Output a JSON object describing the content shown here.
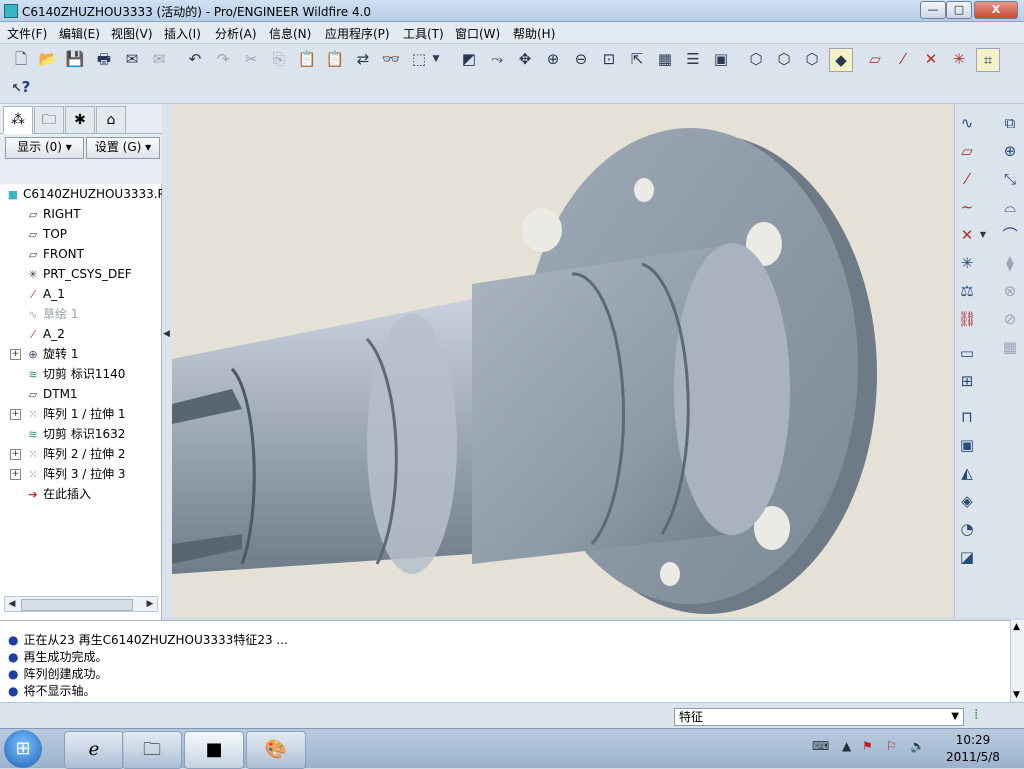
{
  "window": {
    "title": "C6140ZHUZHOU3333 (活动的) - Pro/ENGINEER Wildfire 4.0",
    "controls": {
      "minimize": "—",
      "maximize": "□",
      "close": "X"
    }
  },
  "menu": [
    "文件(F)",
    "编辑(E)",
    "视图(V)",
    "插入(I)",
    "分析(A)",
    "信息(N)",
    "应用程序(P)",
    "工具(T)",
    "窗口(W)",
    "帮助(H)"
  ],
  "toolbar_help_icon": "?",
  "tabs": [
    "model-tree",
    "folder-browser",
    "favorites",
    "connections"
  ],
  "panel": {
    "show_button": "显示 (0)",
    "settings_button": "设置 (G)"
  },
  "tree": {
    "root": "C6140ZHUZHOU3333.P",
    "items": [
      {
        "label": "RIGHT",
        "icon": "datum-plane-icon"
      },
      {
        "label": "TOP",
        "icon": "datum-plane-icon"
      },
      {
        "label": "FRONT",
        "icon": "datum-plane-icon"
      },
      {
        "label": "PRT_CSYS_DEF",
        "icon": "csys-icon"
      },
      {
        "label": "A_1",
        "icon": "axis-icon"
      },
      {
        "label": "草绘 1",
        "icon": "sketch-icon"
      },
      {
        "label": "A_2",
        "icon": "axis-icon"
      },
      {
        "label": "旋转 1",
        "icon": "revolve-icon"
      },
      {
        "label": "切剪 标识1140",
        "icon": "cut-icon"
      },
      {
        "label": "DTM1",
        "icon": "datum-plane-icon"
      },
      {
        "label": "阵列 1 / 拉伸 1",
        "icon": "pattern-icon"
      },
      {
        "label": "切剪 标识1632",
        "icon": "cut-icon"
      },
      {
        "label": "阵列 2 / 拉伸 2",
        "icon": "pattern-icon"
      },
      {
        "label": "阵列 3 / 拉伸 3",
        "icon": "pattern-icon"
      },
      {
        "label": "在此插入",
        "icon": "insert-here-icon"
      }
    ]
  },
  "messages": [
    "正在从23 再生C6140ZHUZHOU3333特征23 ...",
    "再生成功完成。",
    "阵列创建成功。",
    "将不显示轴。"
  ],
  "status": {
    "filter_value": "特征"
  },
  "clock": {
    "time": "10:29",
    "date": "2011/5/8"
  },
  "colors": {
    "part": "#9aa7b5",
    "viewport_bg": "#e5e1d6"
  }
}
